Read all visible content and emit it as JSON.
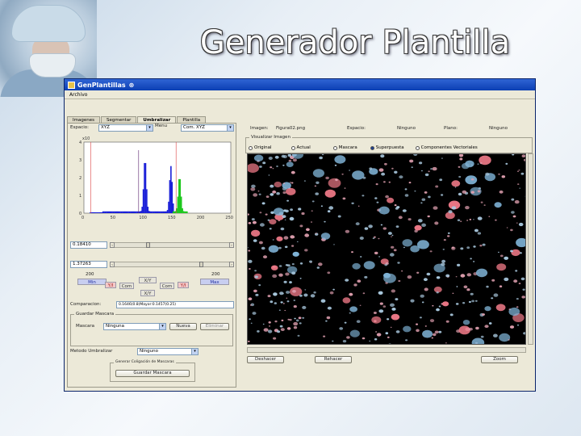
{
  "slide": {
    "title": "Generador Plantilla"
  },
  "window": {
    "title": "GenPlantillas",
    "menu": "Archivo",
    "tabs": [
      "Imagenes",
      "Segmentar",
      "Umbralizar",
      "Plantilla"
    ],
    "active_tab": 2
  },
  "left": {
    "espacio_label": "Espacio:",
    "espacio_value": "XYZ",
    "menu_label": "Menu",
    "menu_value": "Com. XYZ",
    "histogram_corner": "x10",
    "y_ticks": [
      "4",
      "3",
      "2",
      "1",
      "0"
    ],
    "x_ticks": [
      "0",
      "50",
      "100",
      "150",
      "200",
      "250"
    ],
    "field1": "0.18410",
    "field2": "1.37263",
    "min_top": "200",
    "max_top": "200",
    "min_label": "Min",
    "max_label": "Max",
    "chip_mid_left": "Com",
    "chip_mid_top": "X/Y",
    "chip_mid_right": "Com",
    "chip_left_red": "Y/I",
    "chip_right_red": "Y/I",
    "chip_bottom": "X/Y",
    "comparacion_label": "Comparacion:",
    "comparacion_value": "0.1646(0.8)Mayor:0.1457(0.25)",
    "guardar_group": "Guardar Mascara",
    "mascara_label": "Mascara",
    "mascara_value": "Ninguna",
    "nueva_btn": "Nueva",
    "eliminar_btn": "Eliminar",
    "metodo_label": "Metodo Umbralizar",
    "metodo_value": "Ninguno",
    "generar_group": "Generar Coligación de Mascaras",
    "guardar_btn": "Guardar Mascara"
  },
  "right": {
    "imagen_label": "Imagen:",
    "imagen_value": "Figura02.png",
    "espacio_label": "Espacio:",
    "espacio_value": "Ninguno",
    "plano_label": "Plano:",
    "plano_value": "Ninguno",
    "group_label": "Visualizar Imagen",
    "radios": [
      "Original",
      "Actual",
      "Mascara",
      "Superpuesta",
      "Componentes Vectoriales"
    ],
    "radio_selected": 3,
    "btn_deshacer": "Deshacer",
    "btn_rehacer": "Rehacer",
    "btn_zoom": "Zoom"
  },
  "chart_data": {
    "type": "histogram",
    "x_range": [
      0,
      255
    ],
    "y_range": [
      0,
      4
    ],
    "y_unit": "x10^4",
    "series": [
      {
        "color": "#1a1fd8",
        "peaks": [
          {
            "x": 105,
            "y": 3.0
          },
          {
            "x": 150,
            "y": 2.6
          }
        ]
      },
      {
        "color": "#1ec81e",
        "peaks": [
          {
            "x": 165,
            "y": 2.0
          }
        ]
      }
    ]
  },
  "colors": {
    "titlebar": "#0b3fb3",
    "window_bg": "#ece9d8",
    "blue": "#1a1fd8",
    "green": "#1ec81e"
  }
}
